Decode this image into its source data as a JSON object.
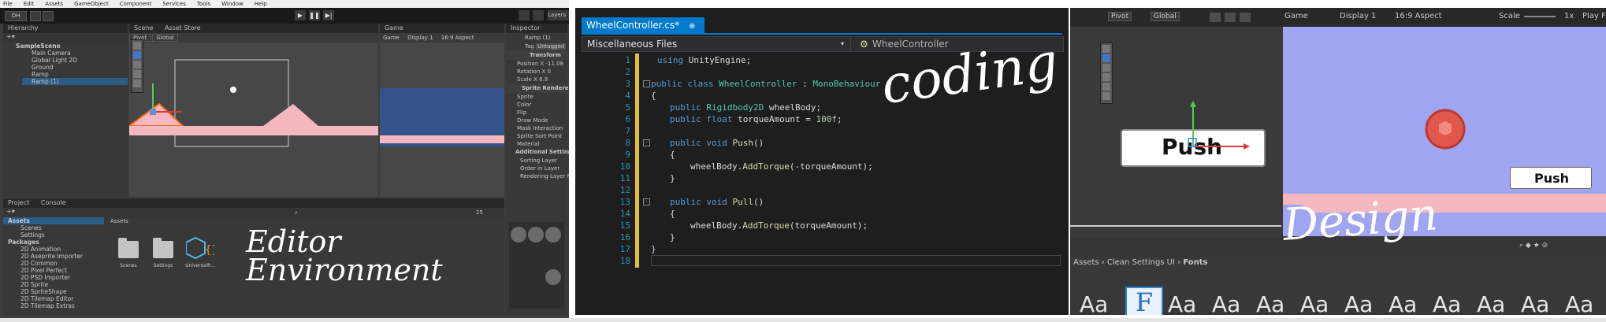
{
  "colors": {
    "accent": "#3d79c4",
    "vs_blue": "#007acc",
    "game_blue": "#9fa5f0",
    "ramp_pink": "#f5b8c0"
  },
  "unity": {
    "menu": [
      "File",
      "Edit",
      "Assets",
      "GameObject",
      "Component",
      "Services",
      "Tools",
      "Window",
      "Help"
    ],
    "account_label": "OH",
    "layers_label": "Layers",
    "hierarchy_tab": "Hierarchy",
    "scene_tab": "Scene",
    "asset_store_tab": "Asset Store",
    "game_tab": "Game",
    "inspector_tab": "Inspector",
    "hierarchy_items": [
      "SampleScene",
      "Main Camera",
      "Global Light 2D",
      "Ground",
      "Ramp",
      "Ramp (1)"
    ],
    "pivot_label": "Pivot",
    "global_label": "Global",
    "game_display": "Display 1",
    "game_aspect": "16:9 Aspect",
    "game_dropdown": "Game",
    "inspector": {
      "object_name": "Ramp (1)",
      "tag_label": "Tag",
      "tag_value": "Untagged",
      "transform_header": "Transform",
      "position_label": "Position",
      "position_x": "X -11.08",
      "rotation_label": "Rotation",
      "rotation_x": "X 0",
      "scale_label": "Scale",
      "scale_x": "X 6.9",
      "sprite_renderer_header": "Sprite Renderer",
      "rows": [
        "Sprite",
        "Color",
        "Flip",
        "Draw Mode",
        "Mask Interaction",
        "Sprite Sort Point",
        "Material"
      ],
      "additional_header": "Additional Settings",
      "additional_rows": [
        "Sorting Layer",
        "Order in Layer",
        "Rendering Layer M"
      ]
    },
    "project_tab": "Project",
    "console_tab": "Console",
    "assets_root": "Assets",
    "project_tree": [
      "Assets",
      "Scenes",
      "Settings",
      "Packages",
      "2D Animation",
      "2D Aseprite Importer",
      "2D Common",
      "2D Pixel Perfect",
      "2D PSD Importer",
      "2D Sprite",
      "2D SpriteShape",
      "2D Tilemap Editor",
      "2D Tilemap Extras"
    ],
    "assets_header": "Assets",
    "asset_items": [
      "Scenes",
      "Settings",
      "UniversalR..."
    ],
    "slider_count": "25",
    "handwriting_line1": "Editor",
    "handwriting_line2": "Environment"
  },
  "vs": {
    "tab_title": "WheelController.cs*",
    "pin_glyph": "⊕",
    "close_glyph": "✕",
    "scope_left": "Miscellaneous Files",
    "scope_right": "WheelController",
    "line_numbers": [
      "1",
      "2",
      "3",
      "4",
      "5",
      "6",
      "7",
      "8",
      "9",
      "10",
      "11",
      "12",
      "13",
      "14",
      "15",
      "16",
      "17",
      "18"
    ],
    "code": {
      "l1_kw": "using",
      "l1_rest": " UnityEngine;",
      "l3_kw": "public class",
      "l3_type": "WheelController",
      "l3_sep": " : ",
      "l3_base": "MonoBehaviour",
      "open_brace": "{",
      "close_brace": "}",
      "l5_kw": "public",
      "l5_type": "Rigidbody2D",
      "l5_rest": " wheelBody;",
      "l6_kw": "public float",
      "l6_rest": " torqueAmount = ",
      "l6_num": "100f",
      "l6_end": ";",
      "l8_kw": "public void",
      "l8_fn": "Push",
      "l8_end": "()",
      "l10_pre": "wheelBody.",
      "l10_fn": "AddTorque",
      "l10_end": "(-torqueAmount);",
      "l13_kw": "public void",
      "l13_fn": "Pull",
      "l13_end": "()",
      "l15_pre": "wheelBody.",
      "l15_fn": "AddTorque",
      "l15_end": "(torqueAmount);"
    },
    "handwriting": "coding"
  },
  "design": {
    "pivot_label": "Pivot",
    "global_label": "Global",
    "game_dropdown": "Game",
    "display_label": "Display 1",
    "aspect_label": "16:9 Aspect",
    "scale_label": "Scale",
    "scale_value": "1x",
    "play_label": "Play Fo",
    "scene_button": "Push",
    "game_button": "Push",
    "breadcrumb": [
      "Assets",
      "Clean Settings UI",
      "Fonts"
    ],
    "font_sample": "Aa",
    "font_selected_glyph": "F",
    "handwriting": "Design"
  }
}
